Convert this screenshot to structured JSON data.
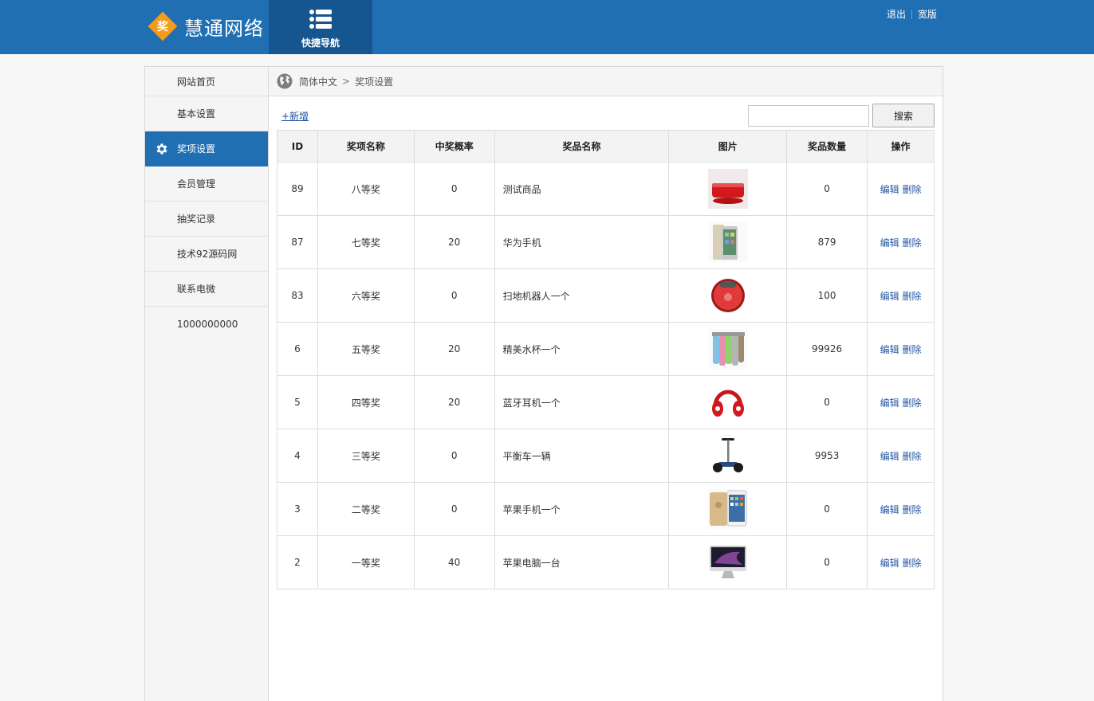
{
  "header": {
    "logo_mark": "奖",
    "logo_text": "慧通网络",
    "quicknav_label": "快捷导航",
    "quicknav_icon": "list-icon",
    "links": [
      "退出",
      "宽版"
    ],
    "colors": {
      "bar": "#1f6fb2",
      "quicknav": "#155590",
      "logo_mark": "#f39b1b"
    }
  },
  "sidebar": {
    "items": [
      {
        "label": "网站首页",
        "active": false
      },
      {
        "label": "基本设置",
        "active": false
      },
      {
        "label": "奖项设置",
        "active": true,
        "icon": "gear-icon"
      },
      {
        "label": "会员管理",
        "active": false
      },
      {
        "label": "抽奖记录",
        "active": false
      },
      {
        "label": "技术92源码网",
        "active": false
      },
      {
        "label": "联系电微",
        "active": false
      },
      {
        "label": "1000000000",
        "active": false
      }
    ]
  },
  "breadcrumb": {
    "icon": "globe-icon",
    "parts": [
      "简体中文",
      ">",
      "奖项设置"
    ]
  },
  "toolbar": {
    "add_label": "+新增",
    "search_value": "",
    "search_button": "搜索"
  },
  "table": {
    "headers": [
      "ID",
      "奖项名称",
      "中奖概率",
      "奖品名称",
      "图片",
      "奖品数量",
      "操作"
    ],
    "rows": [
      {
        "id": "89",
        "level": "八等奖",
        "prob": "0",
        "prize": "测试商品",
        "image": "red-box-image",
        "qty": "0",
        "edit": "编辑",
        "del": "删除"
      },
      {
        "id": "87",
        "level": "七等奖",
        "prob": "20",
        "prize": "华为手机",
        "image": "huawei-phone-image",
        "qty": "879",
        "edit": "编辑",
        "del": "删除"
      },
      {
        "id": "83",
        "level": "六等奖",
        "prob": "0",
        "prize": "扫地机器人一个",
        "image": "robot-vacuum-image",
        "qty": "100",
        "edit": "编辑",
        "del": "删除"
      },
      {
        "id": "6",
        "level": "五等奖",
        "prob": "20",
        "prize": "精美水杯一个",
        "image": "water-cups-image",
        "qty": "99926",
        "edit": "编辑",
        "del": "删除"
      },
      {
        "id": "5",
        "level": "四等奖",
        "prob": "20",
        "prize": "蓝牙耳机一个",
        "image": "headphones-image",
        "qty": "0",
        "edit": "编辑",
        "del": "删除"
      },
      {
        "id": "4",
        "level": "三等奖",
        "prob": "0",
        "prize": "平衡车一辆",
        "image": "balance-scooter-image",
        "qty": "9953",
        "edit": "编辑",
        "del": "删除"
      },
      {
        "id": "3",
        "level": "二等奖",
        "prob": "0",
        "prize": "苹果手机一个",
        "image": "iphone-image",
        "qty": "0",
        "edit": "编辑",
        "del": "删除"
      },
      {
        "id": "2",
        "level": "一等奖",
        "prob": "40",
        "prize": "苹果电脑一台",
        "image": "imac-image",
        "qty": "0",
        "edit": "编辑",
        "del": "删除"
      }
    ]
  }
}
